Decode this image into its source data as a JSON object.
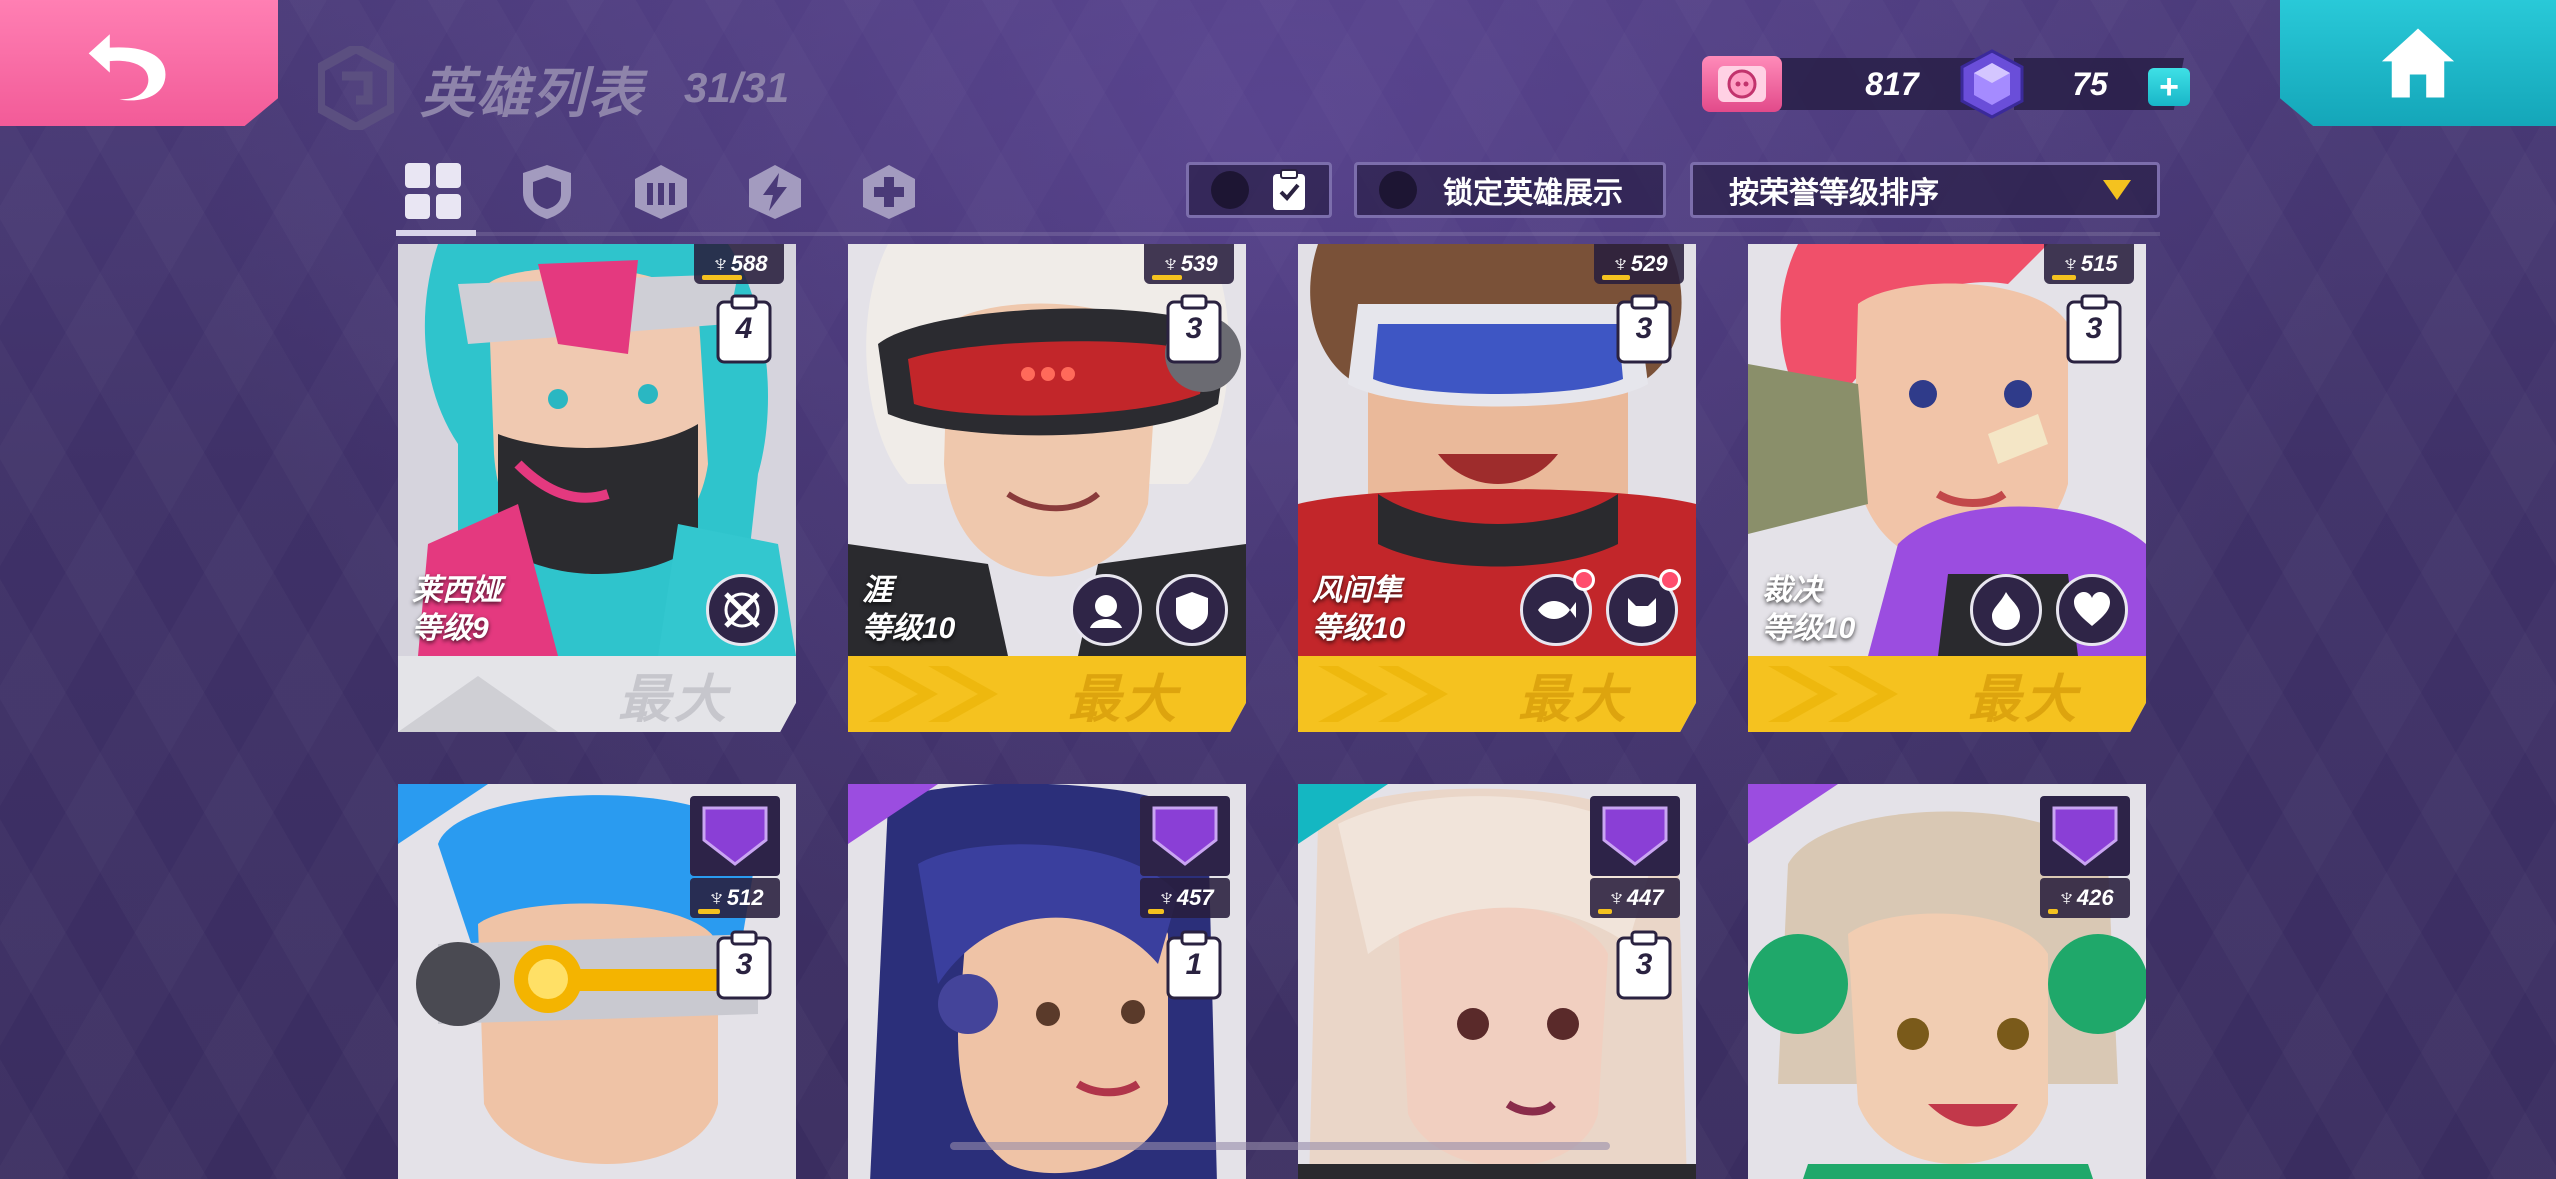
{
  "header": {
    "title": "英雄列表",
    "count": "31/31",
    "tokens": "817",
    "gems": "75",
    "plus_label": "+"
  },
  "filters": {
    "tabs": [
      "all-heroes",
      "defense",
      "support",
      "attack",
      "heal"
    ],
    "toggle_lock_label": "锁定英雄展示",
    "sort_label": "按荣誉等级排序"
  },
  "heroes": [
    {
      "name": "莱西娅",
      "level": "等级9",
      "trophies": "588",
      "cards": "4",
      "max_label": "最大",
      "progress": 0.55
    },
    {
      "name": "涯",
      "level": "等级10",
      "trophies": "539",
      "cards": "3",
      "max_label": "最大",
      "progress": 0.4
    },
    {
      "name": "风间隼",
      "level": "等级10",
      "trophies": "529",
      "cards": "3",
      "max_label": "最大",
      "progress": 0.38
    },
    {
      "name": "裁决",
      "level": "等级10",
      "trophies": "515",
      "cards": "3",
      "max_label": "最大",
      "progress": 0.33
    },
    {
      "name": "",
      "level": "",
      "trophies": "512",
      "cards": "3",
      "max_label": "",
      "progress": 0.3
    },
    {
      "name": "",
      "level": "",
      "trophies": "457",
      "cards": "1",
      "max_label": "",
      "progress": 0.2
    },
    {
      "name": "",
      "level": "",
      "trophies": "447",
      "cards": "3",
      "max_label": "",
      "progress": 0.18
    },
    {
      "name": "",
      "level": "",
      "trophies": "426",
      "cards": "",
      "max_label": "",
      "progress": 0.12
    }
  ],
  "colors": {
    "back_button": "#f25b98",
    "home_button": "#14a6b9",
    "max_band": "#f5c21f",
    "accent_yellow": "#f4c21f",
    "rank_purple": "#8a3fd6"
  }
}
